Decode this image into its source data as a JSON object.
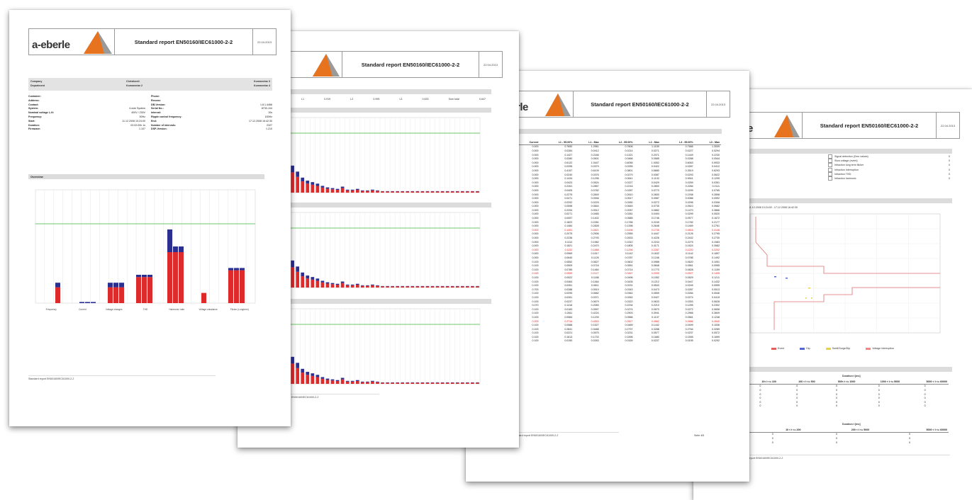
{
  "report": {
    "brand": "a-eberle",
    "brand_partial": "rle",
    "title": "Standard report EN50160/IEC61000-2-2",
    "date": "22.04.2013",
    "footer": "Standard report EN50160/IEC61000-2-2",
    "page_label": "Seite 4/5"
  },
  "page1": {
    "company_row": {
      "c1": "Company",
      "c2": "Christbeeli",
      "c3": "Kommentar 3"
    },
    "department_row": {
      "c1": "Department",
      "c2": "Kommentar 2",
      "c3": "Kommentar 4"
    },
    "info_left": [
      {
        "k": "Customer:",
        "v": ""
      },
      {
        "k": "Address:",
        "v": ""
      },
      {
        "k": "Contact:",
        "v": ""
      },
      {
        "k": "System:",
        "v": "4-wire System"
      },
      {
        "k": "Nominal voltage L-N:",
        "v": "400V / 230V"
      },
      {
        "k": "Frequency:",
        "v": "50Hz"
      },
      {
        "k": "Start:",
        "v": "11.12.2008 10:24:00"
      },
      {
        "k": "Duration:",
        "v": "02:02:00h 1s"
      },
      {
        "k": "Firmware:",
        "v": "1.107"
      }
    ],
    "info_right": [
      {
        "k": "Phone:",
        "v": ""
      },
      {
        "k": "Resonc:",
        "v": ""
      },
      {
        "k": "DB-Version:",
        "v": "1.8.1.4466"
      },
      {
        "k": "Serial No.:",
        "v": "8730-104"
      },
      {
        "k": "Interval:",
        "v": "10s"
      },
      {
        "k": "Ripple control frequency:",
        "v": "183Hz"
      },
      {
        "k": "End:",
        "v": "17.12.2008 16:42:30"
      },
      {
        "k": "Number of intervals:",
        "v": "2327"
      },
      {
        "k": "DSP-Version:",
        "v": "1.210"
      }
    ],
    "overview_label": "Overview",
    "overview_groups": [
      "Frequency",
      "Current",
      "Voltage changes",
      "THD",
      "Harmonic/ ratio",
      "Voltage unbalance",
      "Flicker (Longterm)"
    ]
  },
  "page2": {
    "summary": [
      "L1",
      "0.919",
      "L2",
      "0.995",
      "L3",
      "0.633",
      "Sum total",
      "0.647"
    ]
  },
  "page3": {
    "columns": [
      "Current",
      "L1 - 95.00%",
      "L1 - Max",
      "L2 - 95.00%",
      "L2 - Max",
      "L3 - 95.00%",
      "L3 - Max"
    ],
    "rows": [
      [
        "0.000",
        "0.7650",
        "1.2961",
        "0.7606",
        "1.1159",
        "0.7666",
        "1.3009"
      ],
      [
        "0.000",
        "0.0284",
        "0.0412",
        "0.0214",
        "0.0271",
        "0.0227",
        "0.0294"
      ],
      [
        "0.000",
        "0.1427",
        "0.2166",
        "0.1321",
        "0.2071",
        "0.1449",
        "0.2230"
      ],
      [
        "0.000",
        "0.0280",
        "0.0501",
        "0.0466",
        "0.0585",
        "0.0288",
        "0.0544"
      ],
      [
        "0.000",
        "0.6122",
        "1.0447",
        "0.6055",
        "1.0052",
        "0.6063",
        "0.9933"
      ],
      [
        "0.000",
        "0.0255",
        "0.0379",
        "0.0255",
        "0.0422",
        "0.0287",
        "0.0412"
      ],
      [
        "0.000",
        "0.4157",
        "0.6109",
        "0.3801",
        "0.5680",
        "0.3519",
        "0.6293"
      ],
      [
        "0.000",
        "0.0240",
        "0.0376",
        "0.0279",
        "0.0087",
        "0.0293",
        "0.0622"
      ],
      [
        "0.000",
        "0.1434",
        "0.1296",
        "0.0641",
        "0.1132",
        "0.9941",
        "0.1299"
      ],
      [
        "0.000",
        "0.0423",
        "0.0524",
        "0.0227",
        "0.0429",
        "0.0259",
        "0.0351"
      ],
      [
        "0.000",
        "0.2261",
        "0.2857",
        "0.2216",
        "0.2800",
        "0.2284",
        "0.2111"
      ],
      [
        "0.000",
        "0.0405",
        "0.0782",
        "0.0287",
        "0.0770",
        "0.0299",
        "0.0765"
      ],
      [
        "0.000",
        "0.2275",
        "0.2849",
        "0.2610",
        "0.2600",
        "0.1938",
        "0.2898"
      ],
      [
        "0.000",
        "0.0471",
        "0.0946",
        "0.0517",
        "0.0987",
        "0.0086",
        "0.0992"
      ],
      [
        "0.000",
        "0.0292",
        "0.0229",
        "0.0260",
        "0.0272",
        "0.0296",
        "0.0308"
      ],
      [
        "0.000",
        "0.0598",
        "0.0844",
        "0.0645",
        "0.0735",
        "0.0610",
        "0.0682"
      ],
      [
        "0.000",
        "0.2254",
        "0.0512",
        "0.2057",
        "0.0882",
        "0.1470",
        "0.3866"
      ],
      [
        "0.000",
        "0.0271",
        "0.0465",
        "0.0281",
        "0.0494",
        "0.0299",
        "0.0520"
      ],
      [
        "0.000",
        "0.0057",
        "0.1402",
        "0.0585",
        "0.1746",
        "0.0577",
        "0.1672"
      ],
      [
        "0.000",
        "0.1822",
        "0.2281",
        "0.1766",
        "0.2249",
        "0.1782",
        "0.2177"
      ],
      [
        "0.000",
        "0.1484",
        "0.2828",
        "0.1398",
        "0.2648",
        "0.1469",
        "0.2761"
      ],
      [
        "0.000",
        "0.1491",
        "0.2821",
        "0.4498",
        "0.1736",
        "0.4816",
        "0.4146"
      ],
      [
        "0.000",
        "0.2075",
        "0.2906",
        "0.2555",
        "0.4447",
        "0.2126",
        "0.2795"
      ],
      [
        "0.000",
        "0.2236",
        "0.2793",
        "0.2633",
        "0.4226",
        "0.2432",
        "0.2730"
      ],
      [
        "0.000",
        "0.1112",
        "0.1982",
        "0.1510",
        "0.2234",
        "0.2275",
        "0.1983"
      ],
      [
        "0.000",
        "0.1821",
        "0.2470",
        "0.1805",
        "0.4171",
        "0.1624",
        "0.3582"
      ],
      [
        "0.000",
        "0.1132",
        "0.1888",
        "0.1296",
        "0.2287",
        "0.1220",
        "0.2202"
      ],
      [
        "0.000",
        "0.0969",
        "0.1517",
        "0.1142",
        "0.1632",
        "0.1142",
        "0.1897"
      ],
      [
        "0.000",
        "0.0640",
        "0.1126",
        "0.0787",
        "0.1246",
        "0.0785",
        "0.1492"
      ],
      [
        "0.100",
        "0.0552",
        "0.0827",
        "0.0602",
        "0.0988",
        "0.0620",
        "0.1051"
      ],
      [
        "0.100",
        "0.0509",
        "0.0716",
        "0.0551",
        "0.0848",
        "0.0561",
        "0.0955"
      ],
      [
        "0.100",
        "0.0785",
        "0.1460",
        "0.0714",
        "0.1770",
        "0.0828",
        "0.1159"
      ],
      [
        "0.100",
        "0.0559",
        "0.2127",
        "0.0467",
        "0.2099",
        "0.0527",
        "0.1495"
      ],
      [
        "0.100",
        "0.0522",
        "0.1188",
        "0.0496",
        "0.1052",
        "0.0529",
        "0.1211"
      ],
      [
        "0.100",
        "0.0464",
        "0.1464",
        "0.0435",
        "0.1212",
        "0.0447",
        "0.1432"
      ],
      [
        "0.100",
        "0.0261",
        "0.0611",
        "0.0231",
        "0.0543",
        "0.0245",
        "0.0595"
      ],
      [
        "0.700",
        "0.0288",
        "0.0519",
        "0.0343",
        "0.0473",
        "0.0287",
        "0.0513"
      ],
      [
        "0.100",
        "0.0295",
        "0.0682",
        "0.0362",
        "0.0559",
        "0.0284",
        "0.0546"
      ],
      [
        "0.100",
        "0.0261",
        "0.0371",
        "0.0262",
        "0.0427",
        "0.0274",
        "0.0415"
      ],
      [
        "0.100",
        "0.0237",
        "0.0679",
        "0.0322",
        "0.0633",
        "0.0353",
        "0.0628"
      ],
      [
        "0.070",
        "0.1416",
        "0.2083",
        "0.2234",
        "0.2210",
        "0.1255",
        "0.2302"
      ],
      [
        "0.100",
        "0.0183",
        "0.0597",
        "0.0274",
        "0.0570",
        "0.0272",
        "0.0606"
      ],
      [
        "0.100",
        "0.2811",
        "0.4224",
        "0.2903",
        "0.3941",
        "0.2966",
        "0.3849"
      ],
      [
        "0.100",
        "0.0584",
        "0.1239",
        "0.0566",
        "0.1137",
        "0.0561",
        "0.1248"
      ],
      [
        "0.200",
        "0.2716",
        "0.4553",
        "0.2827",
        "0.4582",
        "0.2686",
        "0.4540"
      ],
      [
        "0.100",
        "0.0588",
        "0.1527",
        "0.0489",
        "0.1442",
        "0.0499",
        "0.1536"
      ],
      [
        "0.100",
        "0.2841",
        "0.3488",
        "0.2797",
        "0.3288",
        "0.2764",
        "0.3289"
      ],
      [
        "0.100",
        "0.0221",
        "0.0575",
        "0.0231",
        "0.0577",
        "0.0237",
        "0.0572"
      ],
      [
        "0.100",
        "0.1613",
        "0.1733",
        "0.1596",
        "0.1680",
        "0.1555",
        "0.1699"
      ],
      [
        "0.100",
        "0.0150",
        "0.0263",
        "0.0159",
        "0.0237",
        "0.0155",
        "0.0292"
      ]
    ],
    "red_rows": [
      21,
      26,
      32,
      44
    ]
  },
  "page4": {
    "events": [
      {
        "label": "Signal detection (Zero values)",
        "v": "0"
      },
      {
        "label": "Slow voltage (event)",
        "v": "0"
      },
      {
        "label": "Infraction long term flicker",
        "v": "0"
      },
      {
        "label": "Infraction Interruption",
        "v": "0"
      },
      {
        "label": "Infraction THD:",
        "v": "0"
      },
      {
        "label": "Infraction harmonic",
        "v": "0"
      }
    ],
    "chart_title": "11.12.2008 10:24:00 - 17.12.2008 16:42:30",
    "legend": [
      "Event",
      "Dip",
      "Swell/Surge/Dip",
      "Voltage interruption"
    ],
    "duration_head": "Duration t [ms]",
    "duration_cols": [
      "10< t <= 100",
      "100 < t <= 500",
      "500< t <= 1000",
      "1000 < t <= 5000",
      "5000 < t <= 60000"
    ],
    "second_head": "Duration t [ms]",
    "second_cols": [
      "10 < t <= 200",
      "200 < t <= 5000",
      "5000 < t <= 60000"
    ],
    "zero": "0",
    "pct_label": "u [%]"
  },
  "chart_data": [
    {
      "type": "bar",
      "title": "Overview",
      "stacked": true,
      "colors": {
        "bottom": "#dd2b2b",
        "top": "#2b2f8f",
        "limit": "#6cc86c"
      },
      "values_red": [
        0.14,
        0,
        0,
        0,
        0.14,
        0.14,
        0.14,
        0.23,
        0.23,
        0.23,
        0.45,
        0.45,
        0.45,
        0.09,
        0.29,
        0.29,
        0.29
      ],
      "values_blue": [
        0.04,
        0.01,
        0.01,
        0.01,
        0.04,
        0.04,
        0.04,
        0.02,
        0.02,
        0.02,
        0.2,
        0.05,
        0.05,
        0,
        0.02,
        0.02,
        0.02
      ],
      "limit": 0.7,
      "ylim": [
        0,
        1
      ]
    }
  ]
}
